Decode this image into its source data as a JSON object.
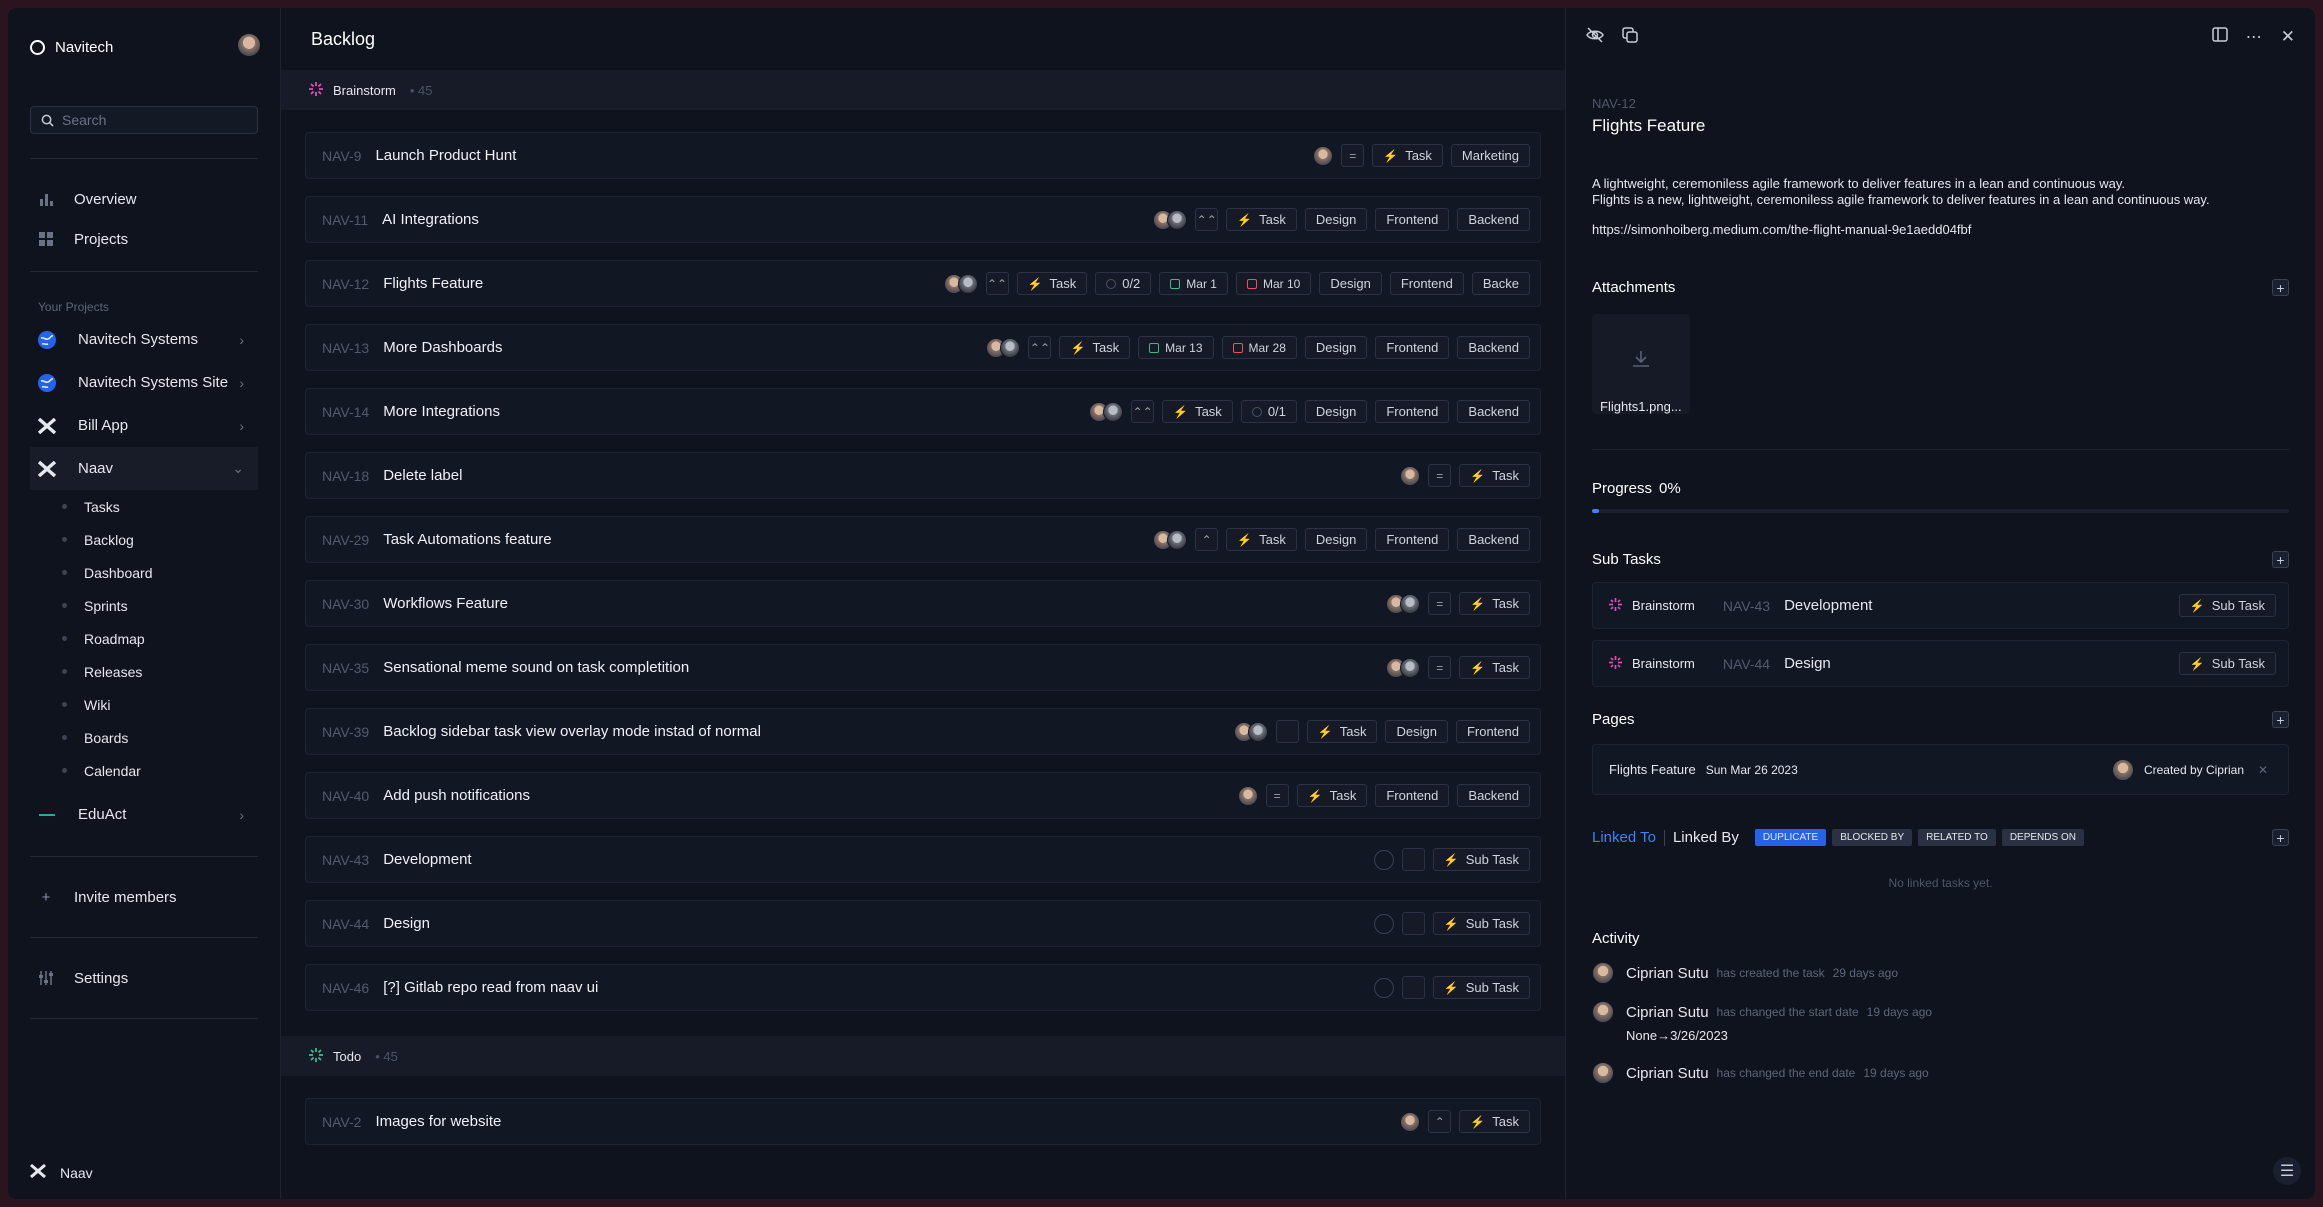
{
  "sidebar": {
    "workspace": "Navitech",
    "search_placeholder": "Search",
    "nav": [
      {
        "label": "Overview",
        "icon": "bar-chart-icon"
      },
      {
        "label": "Projects",
        "icon": "grid-icon"
      }
    ],
    "projects_label": "Your Projects",
    "projects": [
      {
        "label": "Navitech Systems",
        "icon": "globe-icon"
      },
      {
        "label": "Navitech Systems Site",
        "icon": "globe-icon"
      },
      {
        "label": "Bill App",
        "icon": "x-logo-icon"
      }
    ],
    "active_project": "Naav",
    "sub_items": [
      "Tasks",
      "Backlog",
      "Dashboard",
      "Sprints",
      "Roadmap",
      "Releases",
      "Wiki",
      "Boards",
      "Calendar"
    ],
    "other_project": "EduAct",
    "invite": "Invite members",
    "settings": "Settings",
    "footer": "Naav"
  },
  "main": {
    "title": "Backlog",
    "groups": [
      {
        "name": "Brainstorm",
        "count": "45",
        "rows": [
          {
            "id": "NAV-9",
            "title": "Launch Product Hunt",
            "avatars": 1,
            "priority": "=",
            "tags": [
              "Marketing"
            ]
          },
          {
            "id": "NAV-11",
            "title": "AI Integrations",
            "avatars": 2,
            "priority": "⌃⌃",
            "tags": [
              "Design",
              "Frontend",
              "Backend"
            ]
          },
          {
            "id": "NAV-12",
            "title": "Flights Feature",
            "avatars": 2,
            "priority": "⌃⌃",
            "count": "0/2",
            "start": "Mar 1",
            "end": "Mar 10",
            "tags": [
              "Design",
              "Frontend",
              "Backe"
            ]
          },
          {
            "id": "NAV-13",
            "title": "More Dashboards",
            "avatars": 2,
            "priority": "⌃⌃",
            "start": "Mar 13",
            "end": "Mar 28",
            "tags": [
              "Design",
              "Frontend",
              "Backend"
            ]
          },
          {
            "id": "NAV-14",
            "title": "More Integrations",
            "avatars": 2,
            "priority": "⌃⌃",
            "count": "0/1",
            "tags": [
              "Design",
              "Frontend",
              "Backend"
            ]
          },
          {
            "id": "NAV-18",
            "title": "Delete label",
            "avatars": 1,
            "priority": "=",
            "tags": []
          },
          {
            "id": "NAV-29",
            "title": "Task Automations feature",
            "avatars": 2,
            "priority": "⌃",
            "tags": [
              "Design",
              "Frontend",
              "Backend"
            ]
          },
          {
            "id": "NAV-30",
            "title": "Workflows Feature",
            "avatars": 2,
            "priority": "=",
            "tags": []
          },
          {
            "id": "NAV-35",
            "title": "Sensational meme sound on task completition",
            "avatars": 2,
            "priority": "=",
            "tags": []
          },
          {
            "id": "NAV-39",
            "title": "Backlog sidebar task view overlay mode instad of normal",
            "avatars": 2,
            "priority": "",
            "tags": [
              "Design",
              "Frontend"
            ]
          },
          {
            "id": "NAV-40",
            "title": "Add push notifications",
            "avatars": 1,
            "priority": "=",
            "tags": [
              "Frontend",
              "Backend"
            ]
          },
          {
            "id": "NAV-43",
            "title": "Development",
            "avatars": 0,
            "priority": "",
            "type": "Sub Task",
            "tags": []
          },
          {
            "id": "NAV-44",
            "title": "Design",
            "avatars": 0,
            "priority": "",
            "type": "Sub Task",
            "tags": []
          },
          {
            "id": "NAV-46",
            "title": "[?] Gitlab repo read from naav ui",
            "avatars": 0,
            "priority": "",
            "type": "Sub Task",
            "tags": []
          }
        ]
      },
      {
        "name": "Todo",
        "count": "45",
        "rows": [
          {
            "id": "NAV-2",
            "title": "Images for website",
            "avatars": 1,
            "priority": "⌃",
            "tags": []
          }
        ]
      }
    ],
    "task_label": "Task"
  },
  "detail": {
    "id": "NAV-12",
    "title": "Flights Feature",
    "desc1": "A lightweight, ceremoniless agile framework to deliver features in a lean and continuous way.",
    "desc2": "Flights is a new, lightweight, ceremoniless agile framework to deliver features in a lean and continuous way.",
    "link": "https://simonhoiberg.medium.com/the-flight-manual-9e1aedd04fbf",
    "attachments_label": "Attachments",
    "attachment_name": "Flights1.png...",
    "progress_label": "Progress",
    "progress_value": "0%",
    "progress_fraction": 0.01,
    "subtasks_label": "Sub Tasks",
    "subtasks": [
      {
        "status": "Brainstorm",
        "id": "NAV-43",
        "title": "Development",
        "type": "Sub Task"
      },
      {
        "status": "Brainstorm",
        "id": "NAV-44",
        "title": "Design",
        "type": "Sub Task"
      }
    ],
    "pages_label": "Pages",
    "page": {
      "title": "Flights Feature",
      "date": "Sun Mar 26 2023",
      "creator": "Created by Ciprian"
    },
    "linked_to": "Linked To",
    "linked_by": "Linked By",
    "link_types": [
      "DUPLICATE",
      "BLOCKED BY",
      "RELATED TO",
      "DEPENDS ON"
    ],
    "no_linked": "No linked tasks yet.",
    "activity_label": "Activity",
    "activity": [
      {
        "user": "Ciprian Sutu",
        "what": "has created the task",
        "when": "29 days ago"
      },
      {
        "user": "Ciprian Sutu",
        "what": "has changed the start date",
        "when": "19 days ago",
        "from": "None",
        "to": "3/26/2023"
      },
      {
        "user": "Ciprian Sutu",
        "what": "has changed the end date",
        "when": "19 days ago"
      }
    ]
  },
  "colors": {
    "accent": "#3b82f6",
    "brainstorm": "#e04fb4",
    "todo": "#3fb88a",
    "task_bolt": "#f08a3c",
    "subtask_bolt": "#e8c23a"
  }
}
